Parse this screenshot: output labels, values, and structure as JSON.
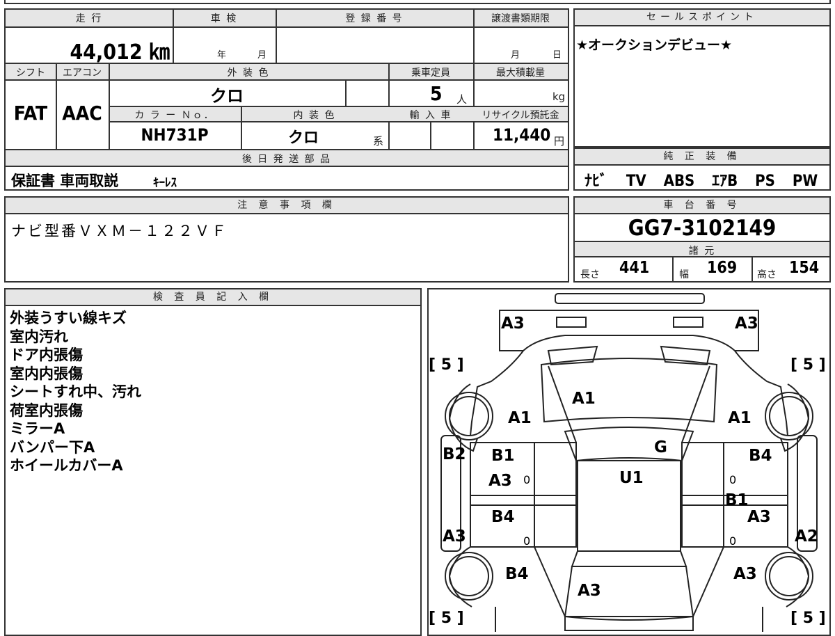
{
  "mileage": {
    "label": "走 行",
    "value": "44,012 ㎞"
  },
  "inspection": {
    "label": "車 検",
    "year_unit": "年",
    "month_unit": "月"
  },
  "registration": {
    "label": "登 録 番 号",
    "value": ""
  },
  "transfer": {
    "label": "譲渡書類期限",
    "month_unit": "月",
    "day_unit": "日"
  },
  "shift": {
    "label": "シフト",
    "value": "FAT"
  },
  "aircon": {
    "label": "エアコン",
    "value": "AAC"
  },
  "exterior": {
    "label": "外 装 色",
    "value": "クロ"
  },
  "capacity": {
    "label": "乗車定員",
    "value": "5",
    "unit": "人"
  },
  "load": {
    "label": "最大積載量",
    "unit": "kg"
  },
  "color_no": {
    "label": "カ ラ ー Ｎｏ．",
    "value": "NH731P"
  },
  "interior": {
    "label": "内 装 色",
    "value": "クロ",
    "suffix": "系"
  },
  "import": {
    "label": "輸 入 車"
  },
  "recycle": {
    "label": "リサイクル預託金",
    "value": "11,440",
    "unit": "円"
  },
  "sales": {
    "label": "セールスポイント",
    "text": "★オークションデビュー★"
  },
  "later": {
    "label": "後 日 発 送 部 品",
    "text": "保証書 車両取説",
    "small": "ｷｰﾚｽ"
  },
  "equipment": {
    "label": "純 正 装 備",
    "items": [
      "ﾅﾋﾞ",
      "TV",
      "ABS",
      "ｴｱB",
      "PS",
      "PW"
    ]
  },
  "notes": {
    "label": "注 意 事 項 欄",
    "text": "ナビ型番ＶＸＭ－１２２ＶＦ"
  },
  "chassis": {
    "label": "車 台 番 号",
    "value": "GG7-3102149"
  },
  "specs": {
    "label": "諸 元",
    "length_label": "長さ",
    "length": "441",
    "width_label": "幅",
    "width": "169",
    "height_label": "高さ",
    "height": "154"
  },
  "inspector": {
    "label": "検 査 員 記 入 欄",
    "lines": [
      "外装うすい線キズ",
      "室内汚れ",
      "ドア内張傷",
      "室内内張傷",
      "シートすれ中、汚れ",
      "荷室内張傷",
      "ミラーA",
      "バンパー下A",
      "ホイールカバーA"
    ]
  },
  "diagram": {
    "marks": [
      "A3",
      "A3",
      "A1",
      "A1",
      "A1",
      "G",
      "B2",
      "B1",
      "A3",
      "U1",
      "B4",
      "B1",
      "B4",
      "A3",
      "A3",
      "A2",
      "B4",
      "A3",
      "A3"
    ],
    "tire_left_top": "[ 5 ]",
    "tire_right_top": "[ 5 ]",
    "tire_left_bottom": "[ 5 ]",
    "tire_right_bottom": "[ 5 ]",
    "zeros": [
      "0",
      "0",
      "0",
      "0"
    ]
  }
}
